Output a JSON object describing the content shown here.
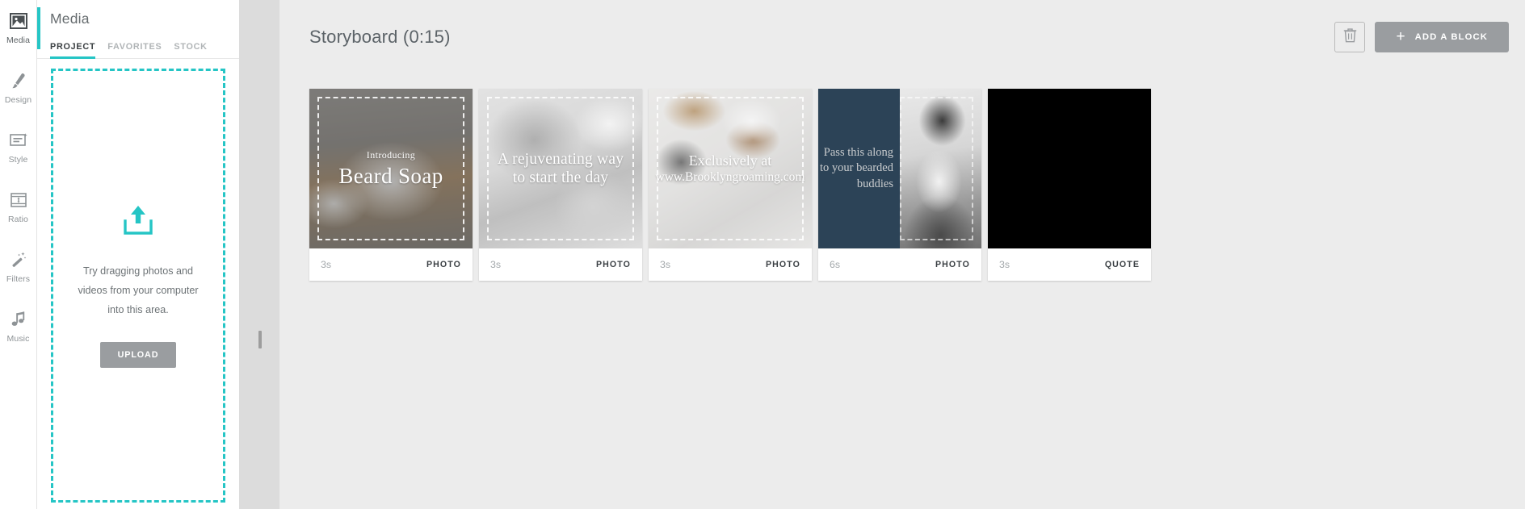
{
  "rail": {
    "items": [
      {
        "label": "Media",
        "icon": "image-icon",
        "active": true
      },
      {
        "label": "Design",
        "icon": "brush-icon",
        "active": false
      },
      {
        "label": "Style",
        "icon": "style-icon",
        "active": false
      },
      {
        "label": "Ratio",
        "icon": "ratio-icon",
        "active": false
      },
      {
        "label": "Filters",
        "icon": "magic-wand-icon",
        "active": false
      },
      {
        "label": "Music",
        "icon": "music-note-icon",
        "active": false
      }
    ]
  },
  "panel": {
    "title": "Media",
    "accent_color": "#25c5c5",
    "tabs": [
      {
        "label": "PROJECT",
        "active": true
      },
      {
        "label": "FAVORITES",
        "active": false
      },
      {
        "label": "STOCK",
        "active": false
      }
    ],
    "dropzone": {
      "icon": "upload-icon",
      "message": "Try dragging photos and videos from your computer into this area.",
      "button_label": "UPLOAD",
      "button_color": "#9a9da0",
      "border_color": "#25c5c5"
    }
  },
  "main": {
    "header": {
      "title": "Storyboard (0:15)",
      "delete_icon": "trash-icon",
      "add_block_label": "ADD A BLOCK",
      "add_block_icon": "plus-icon",
      "add_block_color": "#9a9da0"
    },
    "cards": [
      {
        "duration": "3s",
        "kind": "PHOTO",
        "art": "beard-soap-product",
        "overlay_small": "Introducing",
        "overlay_large": "Beard Soap"
      },
      {
        "duration": "3s",
        "kind": "PHOTO",
        "art": "barber-shave-bw",
        "overlay_line1": "A rejuvenating way",
        "overlay_line2": "to start the day"
      },
      {
        "duration": "3s",
        "kind": "PHOTO",
        "art": "shaving-kit-flatlay",
        "overlay_line1": "Exclusively at",
        "overlay_line2": "www.Brooklyngroaming.com"
      },
      {
        "duration": "6s",
        "kind": "PHOTO",
        "art": "split-navy-portrait",
        "panel_color": "#2c4357",
        "overlay_text": "Pass this along to your bearded buddies"
      },
      {
        "duration": "3s",
        "kind": "QUOTE",
        "art": "black-quote-block",
        "panel_color": "#000000"
      }
    ]
  }
}
